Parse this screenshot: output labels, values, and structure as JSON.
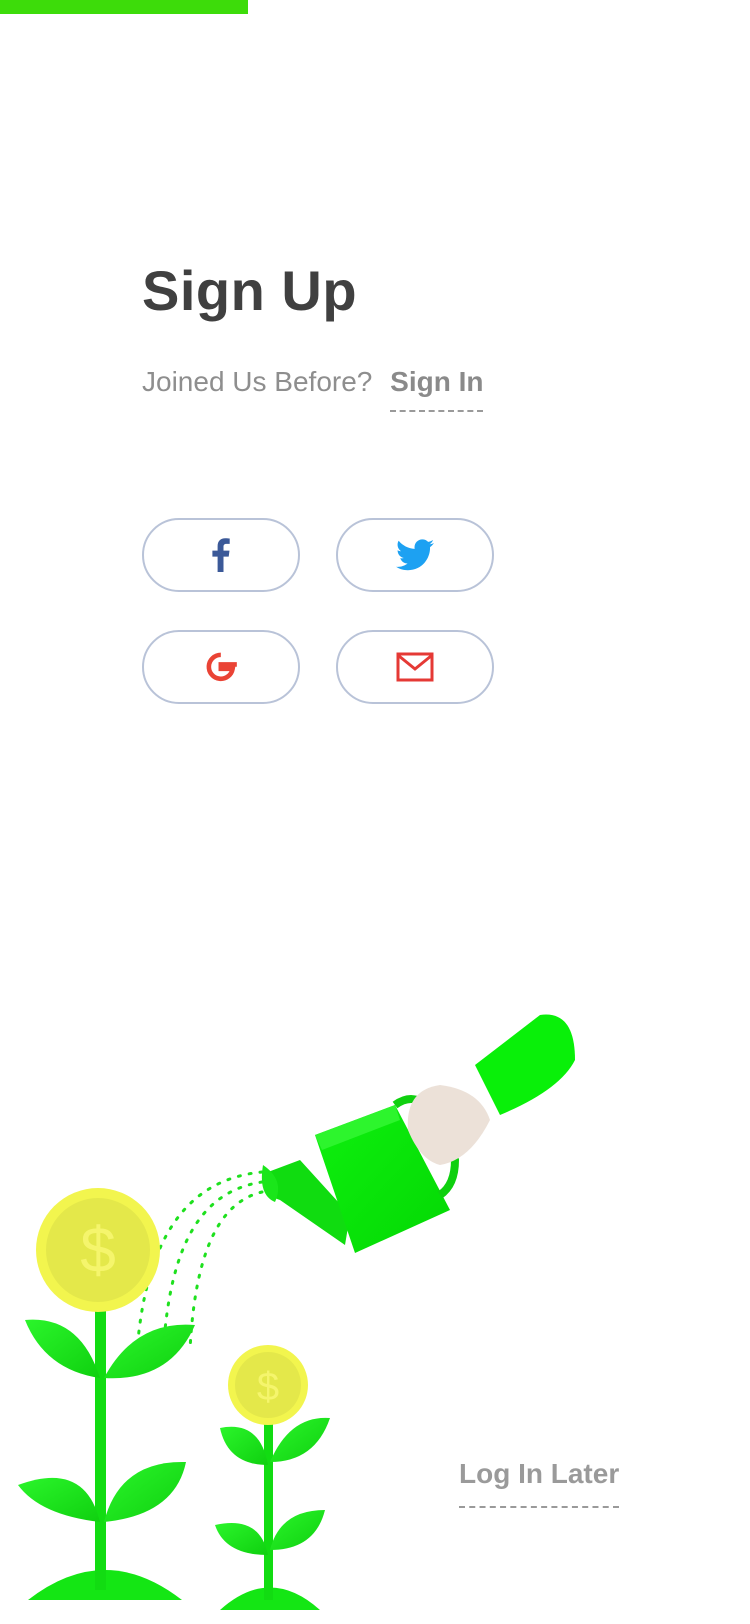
{
  "progress": {
    "value_fraction": 0.33,
    "color": "#3ddc0a"
  },
  "header": {
    "title": "Sign Up"
  },
  "account": {
    "prompt": "Joined Us Before?",
    "signin_label": "Sign In"
  },
  "social": {
    "buttons": [
      {
        "icon": "facebook-icon",
        "color": "#3b5998"
      },
      {
        "icon": "twitter-icon",
        "color": "#1da1f2"
      },
      {
        "icon": "google-icon",
        "color": "#ea4335"
      },
      {
        "icon": "email-icon",
        "color": "#e53935"
      }
    ]
  },
  "footer": {
    "login_later_label": "Log In Later"
  },
  "illustration": {
    "coin_symbol_large": "$",
    "coin_symbol_small": "$",
    "colors": {
      "plant": "#18e618",
      "coin": "#e4e84a",
      "coin_rim": "#f2f54e"
    }
  }
}
